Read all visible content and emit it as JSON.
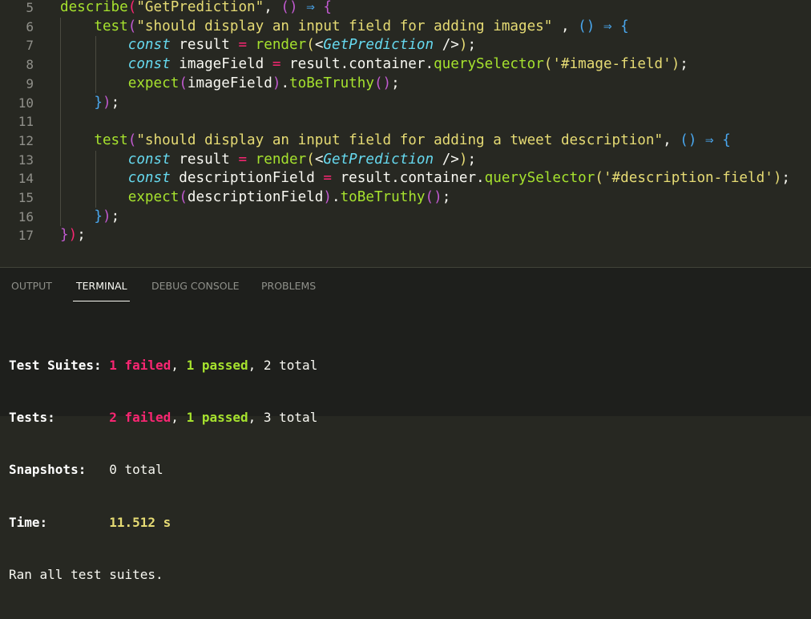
{
  "editor": {
    "lines": [
      {
        "num": "5",
        "tokens": [
          {
            "t": "describe",
            "c": "fn"
          },
          {
            "t": "(",
            "c": "p1"
          },
          {
            "t": "\"GetPrediction\"",
            "c": "str"
          },
          {
            "t": ", ",
            "c": "pn"
          },
          {
            "t": "()",
            "c": "p2"
          },
          {
            "t": " ",
            "c": "pn"
          },
          {
            "t": "⇒",
            "c": "p3"
          },
          {
            "t": " ",
            "c": "pn"
          },
          {
            "t": "{",
            "c": "p2"
          }
        ]
      },
      {
        "num": "6",
        "tokens": [
          {
            "t": "    ",
            "c": "pn"
          },
          {
            "t": "test",
            "c": "fn"
          },
          {
            "t": "(",
            "c": "p2"
          },
          {
            "t": "\"should display an input field for adding images\"",
            "c": "str"
          },
          {
            "t": " , ",
            "c": "pn"
          },
          {
            "t": "()",
            "c": "p3"
          },
          {
            "t": " ",
            "c": "pn"
          },
          {
            "t": "⇒",
            "c": "p3"
          },
          {
            "t": " ",
            "c": "pn"
          },
          {
            "t": "{",
            "c": "p3"
          }
        ]
      },
      {
        "num": "7",
        "tokens": [
          {
            "t": "        ",
            "c": "pn"
          },
          {
            "t": "const",
            "c": "kw"
          },
          {
            "t": " result ",
            "c": "pn"
          },
          {
            "t": "=",
            "c": "op"
          },
          {
            "t": " ",
            "c": "pn"
          },
          {
            "t": "render",
            "c": "fn"
          },
          {
            "t": "(",
            "c": "str"
          },
          {
            "t": "<",
            "c": "pn"
          },
          {
            "t": "GetPrediction",
            "c": "tagn"
          },
          {
            "t": " />",
            "c": "pn"
          },
          {
            "t": ")",
            "c": "str"
          },
          {
            "t": ";",
            "c": "pn"
          }
        ]
      },
      {
        "num": "8",
        "tokens": [
          {
            "t": "        ",
            "c": "pn"
          },
          {
            "t": "const",
            "c": "kw"
          },
          {
            "t": " imageField ",
            "c": "pn"
          },
          {
            "t": "=",
            "c": "op"
          },
          {
            "t": " result.container.",
            "c": "pn"
          },
          {
            "t": "querySelector",
            "c": "fn"
          },
          {
            "t": "(",
            "c": "str"
          },
          {
            "t": "'#image-field'",
            "c": "strg"
          },
          {
            "t": ")",
            "c": "str"
          },
          {
            "t": ";",
            "c": "pn"
          }
        ]
      },
      {
        "num": "9",
        "tokens": [
          {
            "t": "        ",
            "c": "pn"
          },
          {
            "t": "expect",
            "c": "fn"
          },
          {
            "t": "(",
            "c": "p2"
          },
          {
            "t": "imageField",
            "c": "pn"
          },
          {
            "t": ")",
            "c": "p2"
          },
          {
            "t": ".",
            "c": "pn"
          },
          {
            "t": "toBeTruthy",
            "c": "fn"
          },
          {
            "t": "()",
            "c": "p2"
          },
          {
            "t": ";",
            "c": "pn"
          }
        ]
      },
      {
        "num": "10",
        "tokens": [
          {
            "t": "    ",
            "c": "pn"
          },
          {
            "t": "}",
            "c": "p3"
          },
          {
            "t": ")",
            "c": "p2"
          },
          {
            "t": ";",
            "c": "pn"
          }
        ]
      },
      {
        "num": "11",
        "tokens": []
      },
      {
        "num": "12",
        "tokens": [
          {
            "t": "    ",
            "c": "pn"
          },
          {
            "t": "test",
            "c": "fn"
          },
          {
            "t": "(",
            "c": "p2"
          },
          {
            "t": "\"should display an input field for adding a tweet description\"",
            "c": "str"
          },
          {
            "t": ", ",
            "c": "pn"
          },
          {
            "t": "()",
            "c": "p3"
          },
          {
            "t": " ",
            "c": "pn"
          },
          {
            "t": "⇒",
            "c": "p3"
          },
          {
            "t": " ",
            "c": "pn"
          },
          {
            "t": "{",
            "c": "p3"
          }
        ]
      },
      {
        "num": "13",
        "tokens": [
          {
            "t": "        ",
            "c": "pn"
          },
          {
            "t": "const",
            "c": "kw"
          },
          {
            "t": " result ",
            "c": "pn"
          },
          {
            "t": "=",
            "c": "op"
          },
          {
            "t": " ",
            "c": "pn"
          },
          {
            "t": "render",
            "c": "fn"
          },
          {
            "t": "(",
            "c": "str"
          },
          {
            "t": "<",
            "c": "pn"
          },
          {
            "t": "GetPrediction",
            "c": "tagn"
          },
          {
            "t": " />",
            "c": "pn"
          },
          {
            "t": ")",
            "c": "str"
          },
          {
            "t": ";",
            "c": "pn"
          }
        ]
      },
      {
        "num": "14",
        "tokens": [
          {
            "t": "        ",
            "c": "pn"
          },
          {
            "t": "const",
            "c": "kw"
          },
          {
            "t": " descriptionField ",
            "c": "pn"
          },
          {
            "t": "=",
            "c": "op"
          },
          {
            "t": " result.container.",
            "c": "pn"
          },
          {
            "t": "querySelector",
            "c": "fn"
          },
          {
            "t": "(",
            "c": "str"
          },
          {
            "t": "'#description-field'",
            "c": "strg"
          },
          {
            "t": ")",
            "c": "str"
          },
          {
            "t": ";",
            "c": "pn"
          }
        ]
      },
      {
        "num": "15",
        "tokens": [
          {
            "t": "        ",
            "c": "pn"
          },
          {
            "t": "expect",
            "c": "fn"
          },
          {
            "t": "(",
            "c": "p2"
          },
          {
            "t": "descriptionField",
            "c": "pn"
          },
          {
            "t": ")",
            "c": "p2"
          },
          {
            "t": ".",
            "c": "pn"
          },
          {
            "t": "toBeTruthy",
            "c": "fn"
          },
          {
            "t": "()",
            "c": "p2"
          },
          {
            "t": ";",
            "c": "pn"
          }
        ]
      },
      {
        "num": "16",
        "tokens": [
          {
            "t": "    ",
            "c": "pn"
          },
          {
            "t": "}",
            "c": "p3"
          },
          {
            "t": ")",
            "c": "p2"
          },
          {
            "t": ";",
            "c": "pn"
          }
        ]
      },
      {
        "num": "17",
        "tokens": [
          {
            "t": "}",
            "c": "p2"
          },
          {
            "t": ")",
            "c": "p1"
          },
          {
            "t": ";",
            "c": "pn"
          }
        ]
      }
    ]
  },
  "panel": {
    "tabs": [
      {
        "label": "OUTPUT",
        "active": false
      },
      {
        "label": "TERMINAL",
        "active": true
      },
      {
        "label": "DEBUG CONSOLE",
        "active": false
      },
      {
        "label": "PROBLEMS",
        "active": false
      }
    ]
  },
  "terminal": {
    "suites_label": "Test Suites:",
    "suites_failed": "1 failed",
    "suites_passed": "1 passed",
    "suites_total": "2 total",
    "tests_label": "Tests:",
    "tests_failed": "2 failed",
    "tests_passed": "1 passed",
    "tests_total": "3 total",
    "snapshots_label": "Snapshots:",
    "snapshots_total": "0 total",
    "time_label": "Time:",
    "time_value": "11.512 s",
    "ran_all": "Ran all test suites."
  }
}
